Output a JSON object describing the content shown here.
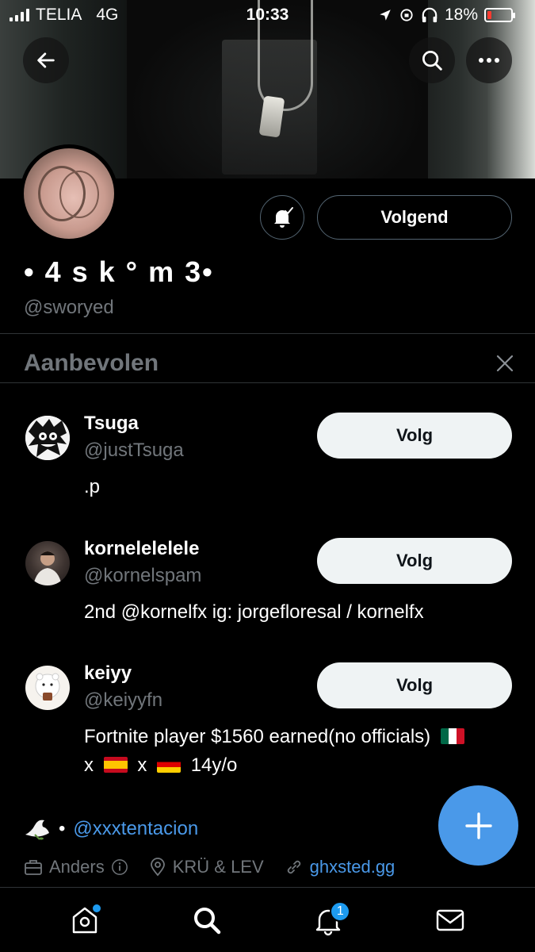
{
  "status_bar": {
    "carrier": "TELIA",
    "network": "4G",
    "time": "10:33",
    "battery": "18%"
  },
  "profile": {
    "display_name": "• 4 s k ° m 3•",
    "handle": "@sworyed",
    "follow_state_label": "Volgend"
  },
  "recommended": {
    "title": "Aanbevolen",
    "items": [
      {
        "name": "Tsuga",
        "handle": "@justTsuga",
        "bio": ".p",
        "follow_label": "Volg"
      },
      {
        "name": "kornelelelele",
        "handle": "@kornelspam",
        "bio": "2nd @kornelfx ig: jorgefloresal / kornelfx",
        "follow_label": "Volg"
      },
      {
        "name": "keiyy",
        "handle": "@keiyyfn",
        "bio_line1": "Fortnite player $1560 earned(no officials)",
        "bio_x1": "x",
        "bio_x2": "x",
        "bio_age": "14y/o",
        "follow_label": "Volg"
      }
    ]
  },
  "bio": {
    "mention": "@xxxtentacion",
    "separator": "•"
  },
  "meta": {
    "category": "Anders",
    "location": "KRÜ & LEV",
    "website": "ghxsted.gg"
  },
  "tabbar": {
    "notification_count": "1"
  },
  "colors": {
    "accent": "#1d9bf0",
    "fab": "#4a99e9",
    "muted": "#71767b",
    "border": "#2f3336"
  }
}
